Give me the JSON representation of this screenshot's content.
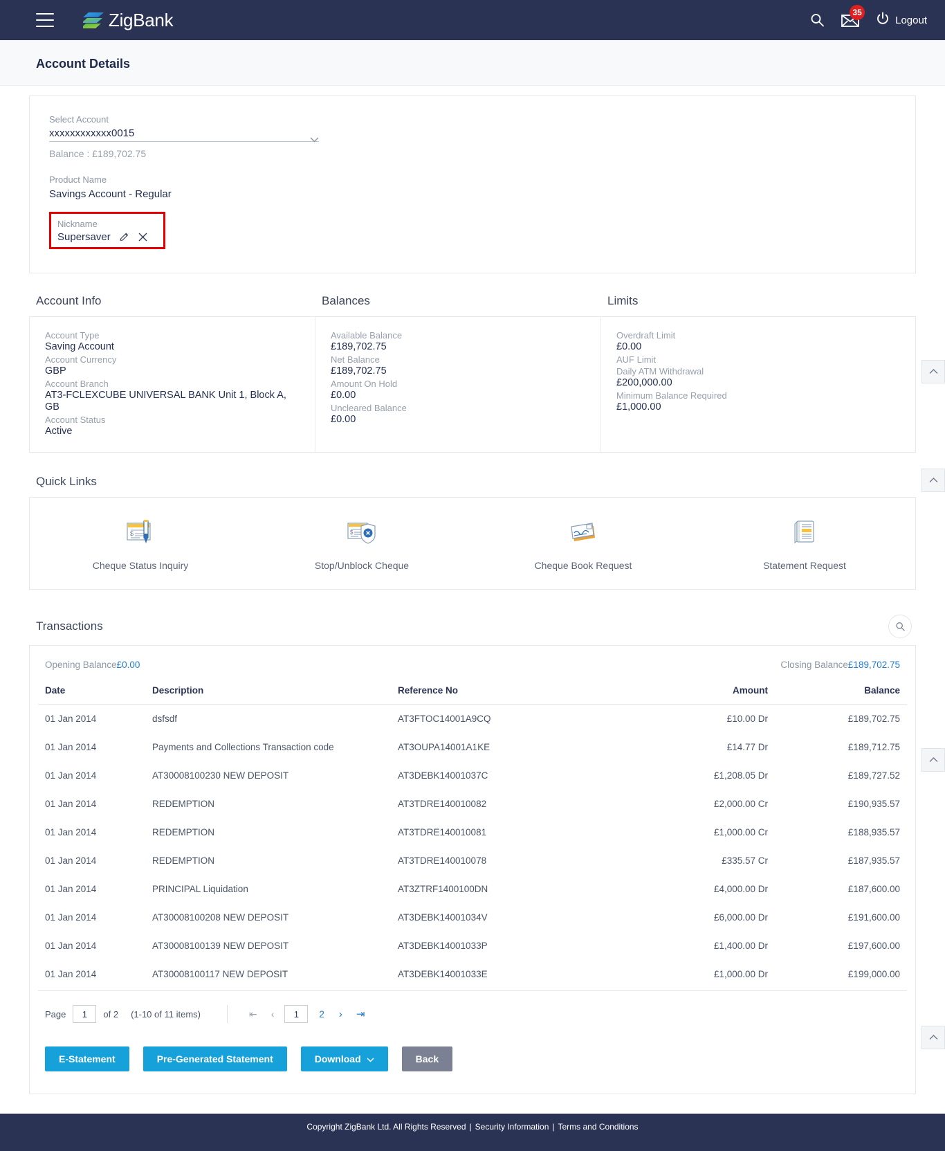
{
  "header": {
    "brand": "ZigBank",
    "menu_icon": "hamburger-icon",
    "search_icon": "search-icon",
    "mail_icon": "mail-icon",
    "mail_badge": "35",
    "logout_label": "Logout",
    "power_icon": "power-icon"
  },
  "page": {
    "title": "Account Details"
  },
  "account_panel": {
    "select_label": "Select Account",
    "select_value": "xxxxxxxxxxxx0015",
    "balance_line": "Balance : £189,702.75",
    "product_label": "Product Name",
    "product_value": "Savings Account - Regular",
    "nickname_label": "Nickname",
    "nickname_value": "Supersaver",
    "edit_icon": "pencil-icon",
    "delete_icon": "close-icon"
  },
  "account_info": {
    "heading": "Account Info",
    "rows": [
      {
        "label": "Account Type",
        "value": "Saving Account"
      },
      {
        "label": "Account Currency",
        "value": "GBP"
      },
      {
        "label": "Account Branch",
        "value": "AT3-FCLEXCUBE UNIVERSAL BANK Unit 1, Block A, GB"
      },
      {
        "label": "Account Status",
        "value": "Active"
      }
    ]
  },
  "balances": {
    "heading": "Balances",
    "rows": [
      {
        "label": "Available Balance",
        "value": "£189,702.75"
      },
      {
        "label": "Net Balance",
        "value": "£189,702.75"
      },
      {
        "label": "Amount On Hold",
        "value": "£0.00"
      },
      {
        "label": "Uncleared Balance",
        "value": "£0.00"
      }
    ]
  },
  "limits": {
    "heading": "Limits",
    "rows": [
      {
        "label": "Overdraft Limit",
        "value": "£0.00"
      },
      {
        "label": "AUF Limit",
        "value": ""
      },
      {
        "label": "Daily ATM Withdrawal",
        "value": "£200,000.00"
      },
      {
        "label": "Minimum Balance Required",
        "value": "£1,000.00"
      }
    ]
  },
  "quick_links": {
    "heading": "Quick Links",
    "items": [
      {
        "label": "Cheque Status Inquiry",
        "icon": "cheque-pen-icon"
      },
      {
        "label": "Stop/Unblock Cheque",
        "icon": "cheque-block-icon"
      },
      {
        "label": "Cheque Book Request",
        "icon": "cheque-book-icon"
      },
      {
        "label": "Statement Request",
        "icon": "statement-icon"
      }
    ]
  },
  "transactions": {
    "heading": "Transactions",
    "search_icon": "search-icon",
    "opening_label": "Opening Balance",
    "opening_value": "£0.00",
    "closing_label": "Closing Balance",
    "closing_value": "£189,702.75",
    "columns": [
      "Date",
      "Description",
      "Reference No",
      "Amount",
      "Balance"
    ],
    "rows": [
      {
        "date": "01 Jan 2014",
        "description": "dsfsdf",
        "reference": "AT3FTOC14001A9CQ",
        "amount": "£10.00 Dr",
        "balance": "£189,702.75"
      },
      {
        "date": "01 Jan 2014",
        "description": "Payments and Collections Transaction code",
        "reference": "AT3OUPA14001A1KE",
        "amount": "£14.77 Dr",
        "balance": "£189,712.75"
      },
      {
        "date": "01 Jan 2014",
        "description": "AT30008100230 NEW DEPOSIT",
        "reference": "AT3DEBK14001037C",
        "amount": "£1,208.05 Dr",
        "balance": "£189,727.52"
      },
      {
        "date": "01 Jan 2014",
        "description": "REDEMPTION",
        "reference": "AT3TDRE140010082",
        "amount": "£2,000.00 Cr",
        "balance": "£190,935.57"
      },
      {
        "date": "01 Jan 2014",
        "description": "REDEMPTION",
        "reference": "AT3TDRE140010081",
        "amount": "£1,000.00 Cr",
        "balance": "£188,935.57"
      },
      {
        "date": "01 Jan 2014",
        "description": "REDEMPTION",
        "reference": "AT3TDRE140010078",
        "amount": "£335.57 Cr",
        "balance": "£187,935.57"
      },
      {
        "date": "01 Jan 2014",
        "description": "PRINCIPAL Liquidation",
        "reference": "AT3ZTRF1400100DN",
        "amount": "£4,000.00 Dr",
        "balance": "£187,600.00"
      },
      {
        "date": "01 Jan 2014",
        "description": "AT30008100208 NEW DEPOSIT",
        "reference": "AT3DEBK14001034V",
        "amount": "£6,000.00 Dr",
        "balance": "£191,600.00"
      },
      {
        "date": "01 Jan 2014",
        "description": "AT30008100139 NEW DEPOSIT",
        "reference": "AT3DEBK14001033P",
        "amount": "£1,400.00 Dr",
        "balance": "£197,600.00"
      },
      {
        "date": "01 Jan 2014",
        "description": "AT30008100117 NEW DEPOSIT",
        "reference": "AT3DEBK14001033E",
        "amount": "£1,000.00 Dr",
        "balance": "£199,000.00"
      }
    ]
  },
  "pagination": {
    "page_label": "Page",
    "page_value": "1",
    "of_label": "of 2",
    "items_label": "(1-10 of 11 items)",
    "first_icon": "first-page-icon",
    "prev_icon": "prev-page-icon",
    "current_page": "1",
    "page_two": "2",
    "next_icon": "next-page-icon",
    "last_icon": "last-page-icon"
  },
  "actions": {
    "e_statement": "E-Statement",
    "pre_generated": "Pre-Generated Statement",
    "download": "Download",
    "download_icon": "chevron-down-icon",
    "back": "Back"
  },
  "footer": {
    "copyright": "Copyright ZigBank Ltd. All Rights Reserved",
    "security": "Security Information",
    "terms": "Terms and Conditions",
    "sep": "|"
  },
  "colors": {
    "header_bg": "#2b3354",
    "accent_blue": "#17a1da",
    "link_blue": "#1f7bd0",
    "badge_red": "#e02020",
    "highlight_red": "#e60000",
    "grey_btn": "#7b8192"
  }
}
